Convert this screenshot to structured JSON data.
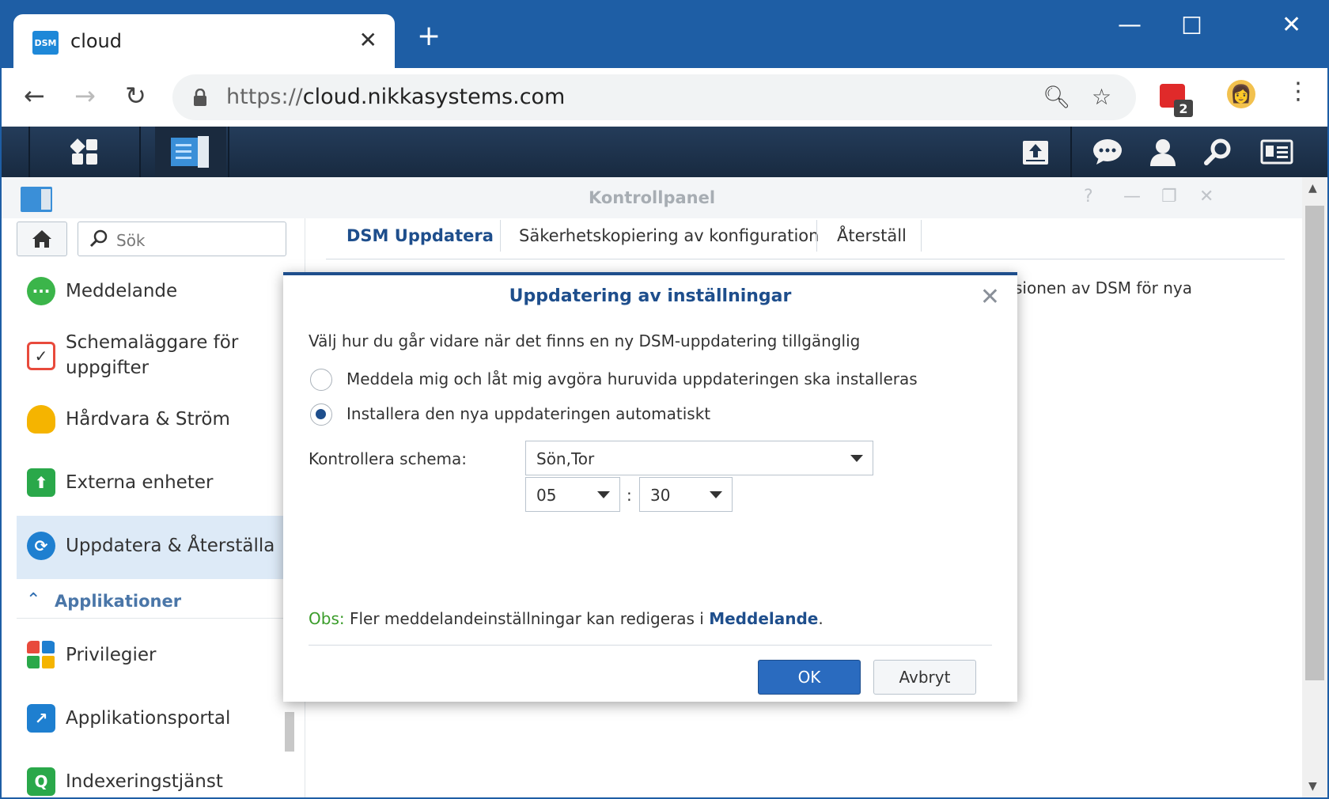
{
  "browser": {
    "tab_title": "cloud",
    "favicon_text": "DSM",
    "url_scheme": "https://",
    "url_host": "cloud.nikkasystems.com",
    "extension_badge_count": "2"
  },
  "window": {
    "title": "Kontrollpanel"
  },
  "sidebar": {
    "search_placeholder": "Sök",
    "items": [
      {
        "label": "Meddelande",
        "icon": "chat-icon",
        "color": "#3bb54a"
      },
      {
        "label": "Schemaläggare för uppgifter",
        "icon": "calendar-icon",
        "color": "#e84a3c"
      },
      {
        "label": "Hårdvara & Ström",
        "icon": "lightbulb-icon",
        "color": "#f5b400"
      },
      {
        "label": "Externa enheter",
        "icon": "upload-icon",
        "color": "#2aa84a"
      },
      {
        "label": "Uppdatera & Återställa",
        "icon": "refresh-icon",
        "color": "#1e7fd0"
      }
    ],
    "section_label": "Applikationer",
    "app_items": [
      {
        "label": "Privilegier",
        "icon": "grid-icon",
        "color": "#e84a3c"
      },
      {
        "label": "Applikationsportal",
        "icon": "portal-icon",
        "color": "#1e7fd0"
      },
      {
        "label": "Indexeringstjänst",
        "icon": "index-search-icon",
        "color": "#2aa84a"
      }
    ]
  },
  "tabs": [
    {
      "label": "DSM Uppdatera",
      "active": true
    },
    {
      "label": "Säkerhetskopiering av konfiguration",
      "active": false
    },
    {
      "label": "Återställ",
      "active": false
    }
  ],
  "background_text": "sionen av DSM för nya",
  "dialog": {
    "title": "Uppdatering av inställningar",
    "description": "Välj hur du går vidare när det finns en ny DSM-uppdatering tillgänglig",
    "options": [
      {
        "label": "Meddela mig och låt mig avgöra huruvida uppdateringen ska installeras",
        "checked": false
      },
      {
        "label": "Installera den nya uppdateringen automatiskt",
        "checked": true
      }
    ],
    "schedule_label": "Kontrollera schema:",
    "schedule_days": "Sön,Tor",
    "hour": "05",
    "minute": "30",
    "time_separator": ":",
    "note_prefix": "Obs:",
    "note_text": " Fler meddelandeinställningar kan redigeras i ",
    "note_link": "Meddelande",
    "note_suffix": ".",
    "ok_label": "OK",
    "cancel_label": "Avbryt"
  },
  "colors": {
    "accent": "#1e4e8c",
    "chrome": "#1e5ea5",
    "taskbar": "#1f3550",
    "obs": "#3a9c2a"
  }
}
